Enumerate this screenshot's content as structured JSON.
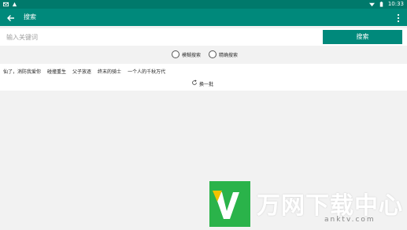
{
  "statusbar": {
    "time": "10:33"
  },
  "appbar": {
    "title": "搜索"
  },
  "search": {
    "placeholder": "输入关键词",
    "button_label": "搜索"
  },
  "options": [
    {
      "label": "模糊搜索"
    },
    {
      "label": "精确搜索"
    }
  ],
  "hotwords": {
    "items": [
      "仙了，消防我爱你",
      "碰撞重生",
      "父子放逐",
      "终末的骑士",
      "一个人的千秋万代"
    ],
    "refresh_label": "换一批"
  },
  "watermark": {
    "name": "万网下载中心",
    "url": "anktv.com"
  },
  "colors": {
    "primary": "#00897b",
    "status": "#00796b",
    "watermark_green": "#2ab34a",
    "watermark_yellow": "#f2c200"
  }
}
